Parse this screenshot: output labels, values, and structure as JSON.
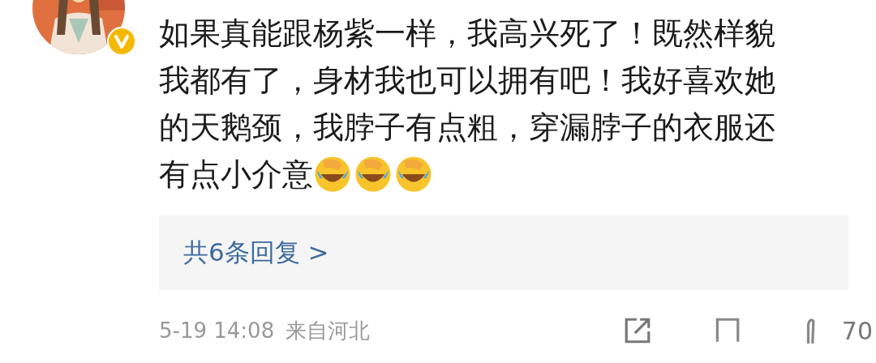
{
  "avatar": {
    "verified": true
  },
  "comment": {
    "lines": [
      "如果真能跟杨紫一样，我高兴死了！既然样貌",
      "我都有了，身材我也可以拥有吧！我好喜欢她",
      "的天鹅颈，我脖子有点粗，穿漏脖子的衣服还",
      "有点小介意"
    ],
    "emojis": [
      {
        "kind": "facepalm-laugh"
      },
      {
        "kind": "facepalm-laugh"
      },
      {
        "kind": "facepalm-laugh"
      }
    ]
  },
  "replies": {
    "label": "共6条回复 >"
  },
  "footer": {
    "time": "5-19 14:08",
    "location": "来自河北",
    "like_count": "70"
  }
}
